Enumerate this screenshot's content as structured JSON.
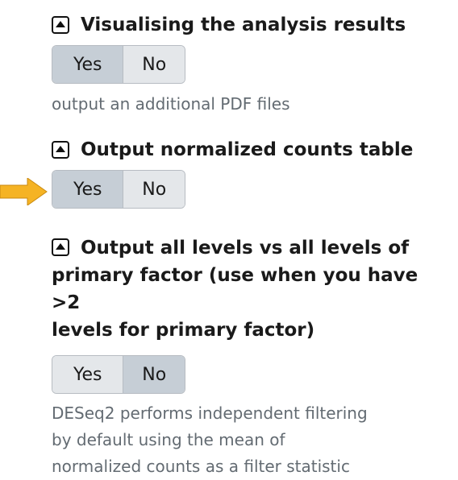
{
  "params": [
    {
      "title": "Visualising the analysis results",
      "toggle": {
        "yes_label": "Yes",
        "no_label": "No",
        "selected": "Yes"
      },
      "help": "output an additional PDF files"
    },
    {
      "title": "Output normalized counts table",
      "toggle": {
        "yes_label": "Yes",
        "no_label": "No",
        "selected": "Yes"
      },
      "help": ""
    },
    {
      "title_lines": [
        "Output all levels vs all levels of",
        "primary factor (use when you have >2",
        "levels for primary factor)"
      ],
      "toggle": {
        "yes_label": "Yes",
        "no_label": "No",
        "selected": "No"
      },
      "help_lines": [
        "DESeq2 performs independent filtering",
        "by default using the mean of",
        "normalized counts as a filter statistic"
      ]
    }
  ],
  "colors": {
    "arrow": "#f5b324",
    "toggle_active": "#c6ced6",
    "toggle_inactive": "#e4e7ea",
    "help_text": "#636b72"
  },
  "icons": {
    "collapse": "collapse-triangle-icon",
    "pointer": "arrow-right-icon"
  }
}
